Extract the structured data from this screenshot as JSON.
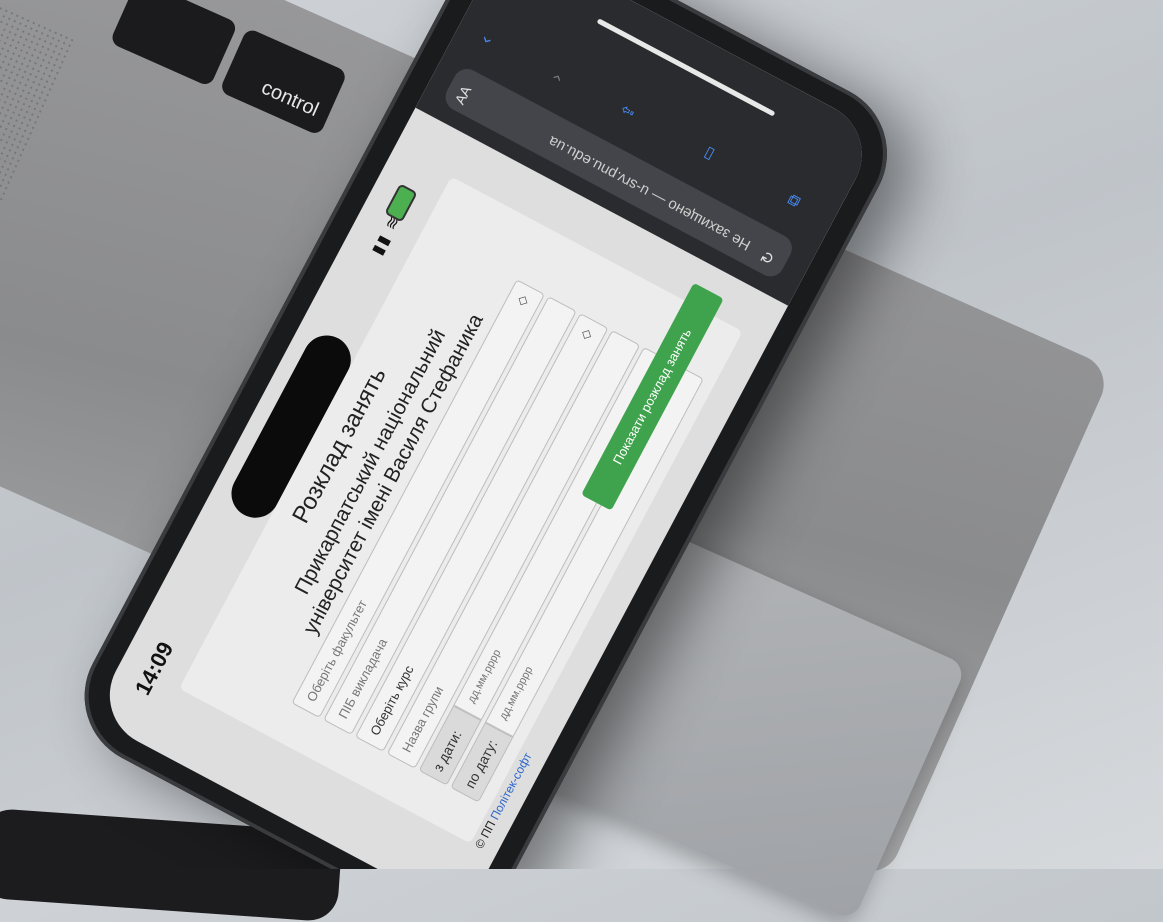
{
  "laptop": {
    "key_label": "control"
  },
  "status_bar": {
    "time": "14:09"
  },
  "page": {
    "title": "Розклад занять",
    "university_line1": "Прикарпатський національний",
    "university_line2": "університет імені Василя Стефаника",
    "faculty_select": "Оберіть факультет",
    "teacher_input_placeholder": "ПІБ викладача",
    "course_select": "Оберіть курс",
    "group_input_placeholder": "Назва групи",
    "from_date_label": "з дати:",
    "from_date_placeholder": "дд.мм.рррр",
    "to_date_label": "по дату:",
    "to_date_placeholder": "дд.мм.рррр",
    "submit_button": "Показати розклад занять",
    "footer_prefix": "© ПП",
    "footer_link": "Політек-софт"
  },
  "browser": {
    "reader_button": "AA",
    "url_text": "Не захищено — u-srv.pnu.edu.ua",
    "reload_icon": "reload-icon",
    "back_icon": "chevron-left-icon",
    "forward_icon": "chevron-right-icon",
    "share_icon": "share-icon",
    "bookmarks_icon": "book-icon",
    "tabs_icon": "tabs-icon"
  },
  "colors": {
    "accent_green": "#3fa34d",
    "link_blue": "#2b64c9"
  }
}
